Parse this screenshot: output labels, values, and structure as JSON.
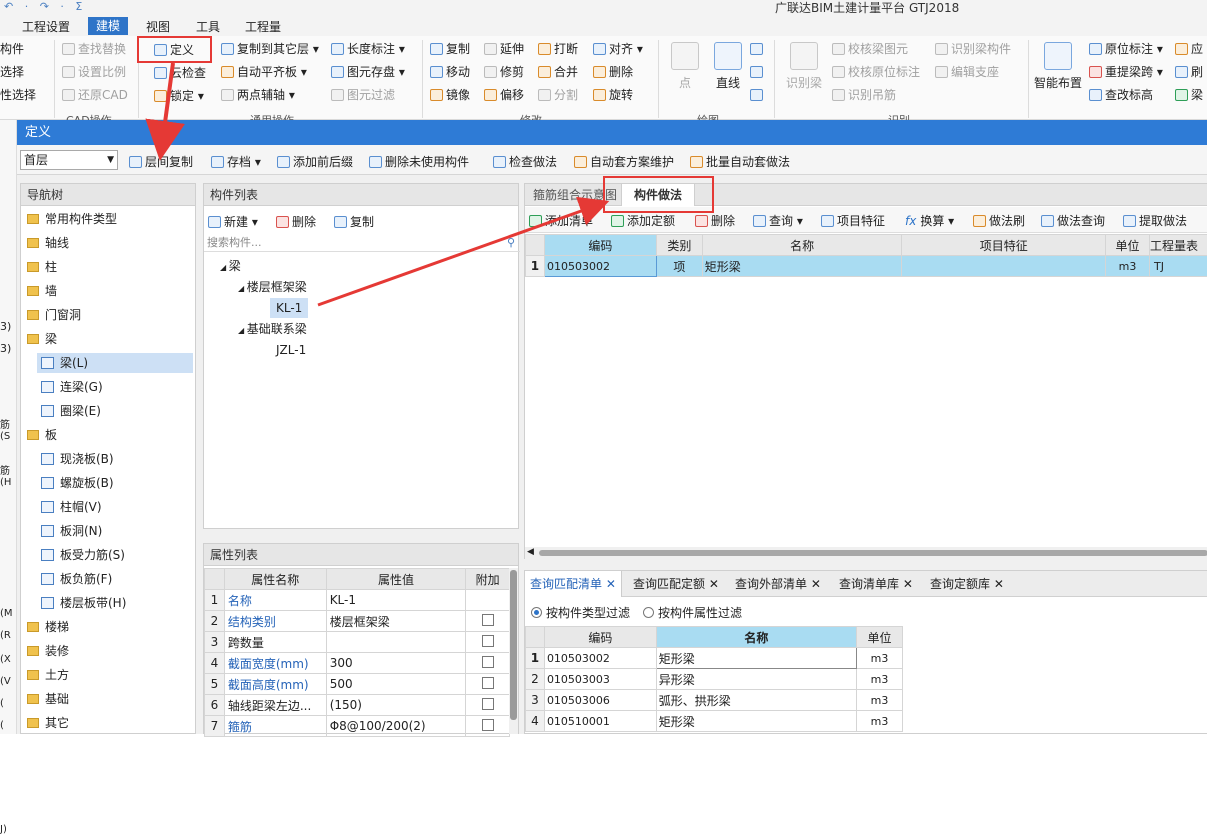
{
  "app_title": "广联达BIM土建计量平台 GTJ2018",
  "quick_access": "↶ · ↷ · Σ",
  "menus": [
    "工程设置",
    "建模",
    "视图",
    "工具",
    "工程量"
  ],
  "ribbon": {
    "cad_left": [
      "构件",
      "选择",
      "性选择"
    ],
    "cad": [
      "查找替换",
      "设置比例",
      "还原CAD"
    ],
    "cad_group": "CAD操作",
    "define": "定义",
    "cloud_check": "云检查",
    "lock": "锁定",
    "copy_to_floor": "复制到其它层",
    "auto_slab": "自动平齐板",
    "two_point": "两点辅轴",
    "length_mark": "长度标注",
    "elem_save": "图元存盘",
    "elem_filter": "图元过滤",
    "general_group": "通用操作",
    "copy": "复制",
    "extend": "延伸",
    "break": "打断",
    "align": "对齐",
    "move": "移动",
    "trim": "修剪",
    "merge": "合并",
    "delete": "删除",
    "mirror": "镜像",
    "offset": "偏移",
    "split": "分割",
    "rotate": "旋转",
    "modify_group": "修改",
    "point": "点",
    "line": "直线",
    "draw_group": "绘图",
    "recog_beam": "识别梁",
    "check_beam": "校核梁图元",
    "check_mark": "校核原位标注",
    "recog_hanger": "识别吊筋",
    "recog_beam_elem": "识别梁构件",
    "edit_support": "编辑支座",
    "recog_group": "识别",
    "smart_layout": "智能布置",
    "orig_mark": "原位标注",
    "re_span": "重提梁跨",
    "edit_height": "查改标高",
    "right_cut": [
      "应",
      "刷",
      "梁"
    ]
  },
  "dialog": {
    "title": "定义",
    "floor": "首层",
    "toolbar": [
      "层间复制",
      "存档",
      "添加前后缀",
      "删除未使用构件",
      "检查做法",
      "自动套方案维护",
      "批量自动套做法"
    ]
  },
  "nav": {
    "title": "导航树",
    "items": [
      {
        "label": "常用构件类型",
        "type": "folder"
      },
      {
        "label": "轴线",
        "type": "folder"
      },
      {
        "label": "柱",
        "type": "folder"
      },
      {
        "label": "墙",
        "type": "folder"
      },
      {
        "label": "门窗洞",
        "type": "folder"
      },
      {
        "label": "梁",
        "type": "folder"
      },
      {
        "label": "梁(L)",
        "type": "sub",
        "selected": true
      },
      {
        "label": "连梁(G)",
        "type": "sub"
      },
      {
        "label": "圈梁(E)",
        "type": "sub"
      },
      {
        "label": "板",
        "type": "folder"
      },
      {
        "label": "现浇板(B)",
        "type": "sub"
      },
      {
        "label": "螺旋板(B)",
        "type": "sub"
      },
      {
        "label": "柱帽(V)",
        "type": "sub"
      },
      {
        "label": "板洞(N)",
        "type": "sub"
      },
      {
        "label": "板受力筋(S)",
        "type": "sub"
      },
      {
        "label": "板负筋(F)",
        "type": "sub"
      },
      {
        "label": "楼层板带(H)",
        "type": "sub"
      },
      {
        "label": "楼梯",
        "type": "folder"
      },
      {
        "label": "装修",
        "type": "folder"
      },
      {
        "label": "土方",
        "type": "folder"
      },
      {
        "label": "基础",
        "type": "folder"
      },
      {
        "label": "其它",
        "type": "folder"
      }
    ]
  },
  "left_strip": [
    "3)",
    "3)",
    "筋(S",
    "筋(H",
    "(M",
    "(R",
    "(X",
    "(V",
    "(",
    "(",
    "J)"
  ],
  "components": {
    "title": "构件列表",
    "new": "新建",
    "delete": "删除",
    "copy": "复制",
    "search_placeholder": "搜索构件...",
    "tree": [
      {
        "label": "梁",
        "level": 0,
        "toggle": "◢"
      },
      {
        "label": "楼层框架梁",
        "level": 1,
        "toggle": "◢"
      },
      {
        "label": "KL-1",
        "level": 2,
        "selected": true
      },
      {
        "label": "基础联系梁",
        "level": 1,
        "toggle": "◢"
      },
      {
        "label": "JZL-1",
        "level": 2
      }
    ]
  },
  "props": {
    "title": "属性列表",
    "headers": [
      "属性名称",
      "属性值",
      "附加"
    ],
    "rows": [
      {
        "n": "1",
        "name": "名称",
        "value": "KL-1",
        "blue": true,
        "chk": false
      },
      {
        "n": "2",
        "name": "结构类别",
        "value": "楼层框架梁",
        "blue": true,
        "chk": true
      },
      {
        "n": "3",
        "name": "跨数量",
        "value": "",
        "blue": false,
        "chk": true
      },
      {
        "n": "4",
        "name": "截面宽度(mm)",
        "value": "300",
        "blue": true,
        "chk": true
      },
      {
        "n": "5",
        "name": "截面高度(mm)",
        "value": "500",
        "blue": true,
        "chk": true
      },
      {
        "n": "6",
        "name": "轴线距梁左边...",
        "value": "(150)",
        "blue": false,
        "chk": true
      },
      {
        "n": "7",
        "name": "箍筋",
        "value": "Φ8@100/200(2)",
        "blue": true,
        "chk": true
      }
    ]
  },
  "method": {
    "tabs": [
      "箍筋组合示意图",
      "构件做法"
    ],
    "toolbar": [
      "添加清单",
      "添加定额",
      "删除",
      "查询",
      "项目特征",
      "换算",
      "做法刷",
      "做法查询",
      "提取做法"
    ],
    "headers": [
      "编码",
      "类别",
      "名称",
      "项目特征",
      "单位",
      "工程量表"
    ],
    "rows": [
      {
        "n": "1",
        "code": "010503002",
        "cat": "项",
        "name": "矩形梁",
        "feature": "",
        "unit": "m3",
        "expr": "TJ"
      }
    ]
  },
  "query": {
    "tabs": [
      "查询匹配清单",
      "查询匹配定额",
      "查询外部清单",
      "查询清单库",
      "查询定额库"
    ],
    "filter1": "按构件类型过滤",
    "filter2": "按构件属性过滤",
    "headers": [
      "编码",
      "名称",
      "单位"
    ],
    "rows": [
      {
        "n": "1",
        "code": "010503002",
        "name": "矩形梁",
        "unit": "m3"
      },
      {
        "n": "2",
        "code": "010503003",
        "name": "异形梁",
        "unit": "m3"
      },
      {
        "n": "3",
        "code": "010503006",
        "name": "弧形、拱形梁",
        "unit": "m3"
      },
      {
        "n": "4",
        "code": "010510001",
        "name": "矩形梁",
        "unit": "m3"
      }
    ]
  },
  "colors": {
    "accent": "#2e7bd6",
    "highlight": "#e53935",
    "selected_row": "#a9dcf2"
  }
}
